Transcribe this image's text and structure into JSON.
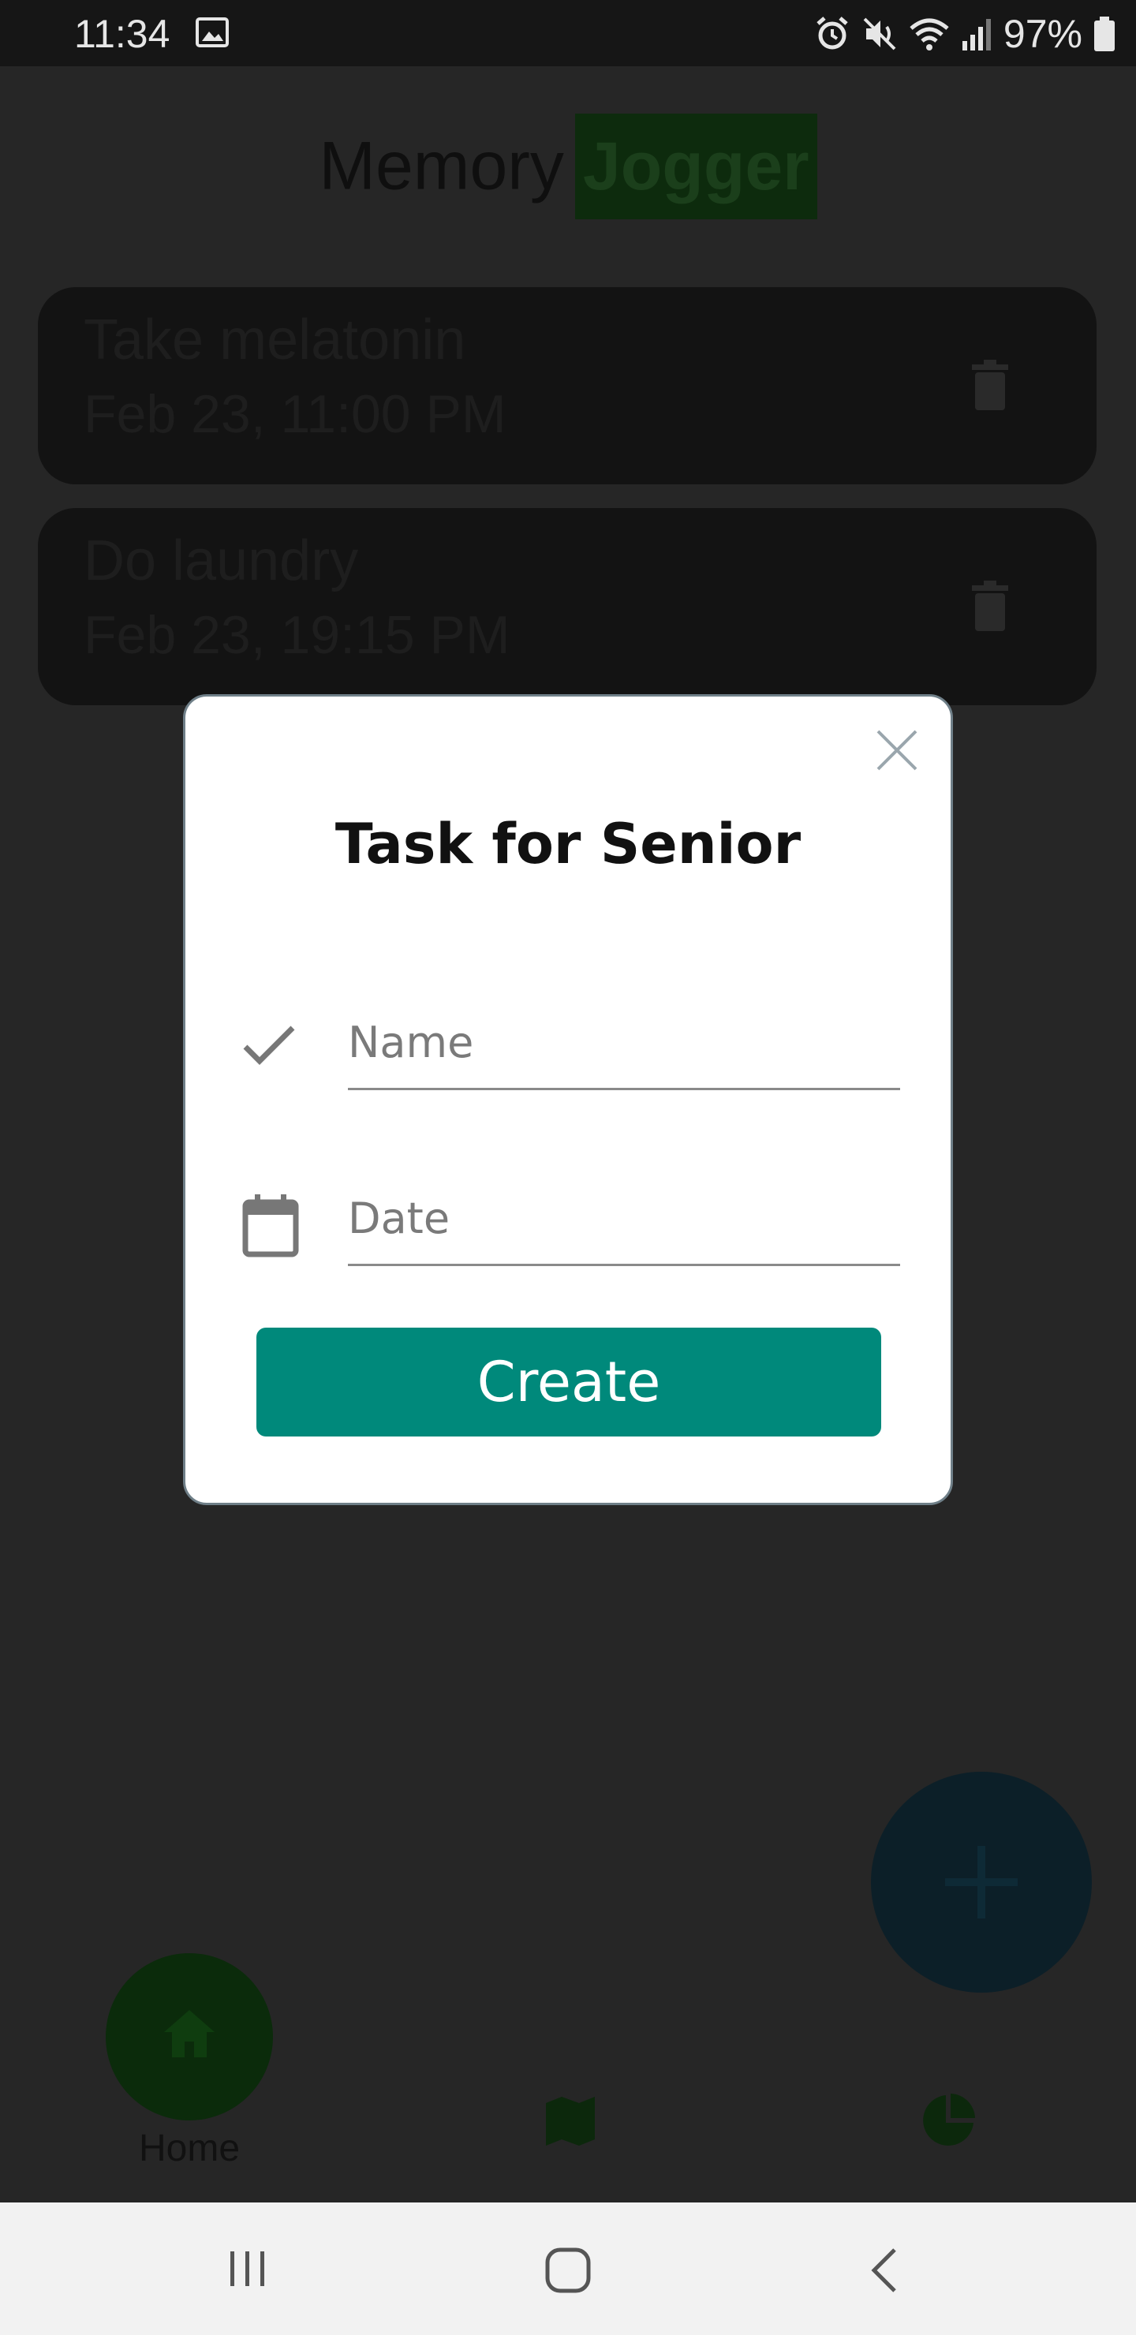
{
  "status_bar": {
    "time": "11:34",
    "battery": "97%"
  },
  "app": {
    "brand_word1": "Memory",
    "brand_word2": "Jogger",
    "tasks": [
      {
        "name": "Take melatonin",
        "date": "Feb 23, 11:00 PM"
      },
      {
        "name": "Do laundry",
        "date": "Feb 23, 19:15 PM"
      }
    ],
    "nav": {
      "home_label": "Home"
    }
  },
  "dialog": {
    "title": "Task for Senior",
    "name_placeholder": "Name",
    "date_placeholder": "Date",
    "create_label": "Create"
  },
  "colors": {
    "accent": "#00897b",
    "dialog_bg": "#ffffff",
    "system_nav_bg": "#f2f2f2"
  },
  "icons": [
    "image-icon",
    "alarm-icon",
    "mute-icon",
    "wifi-icon",
    "signal-icon",
    "battery-icon",
    "trash-icon",
    "plus-icon",
    "home-icon",
    "map-icon",
    "pie-chart-icon",
    "close-icon",
    "check-icon",
    "calendar-icon",
    "recents-icon",
    "home-circle-icon",
    "back-icon"
  ]
}
